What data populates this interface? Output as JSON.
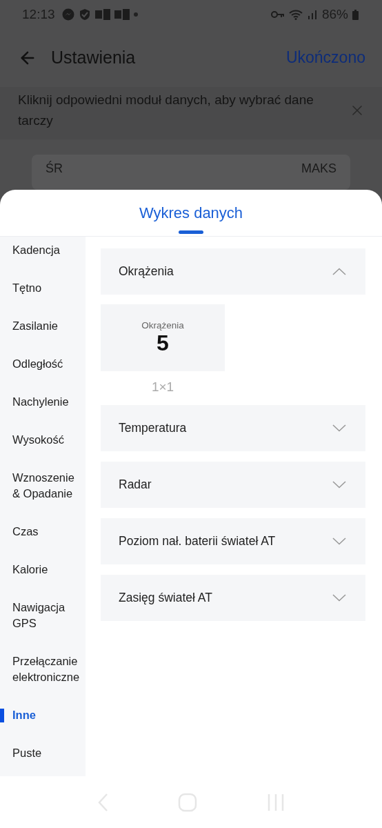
{
  "status_bar": {
    "time": "12:13",
    "battery": "86%"
  },
  "header": {
    "title": "Ustawienia",
    "action": "Ukończono"
  },
  "banner": {
    "text": "Kliknij odpowiedni moduł danych, aby wybrać dane tarczy"
  },
  "card": {
    "left": "ŚR",
    "right": "MAKS"
  },
  "sheet": {
    "title": "Wykres danych",
    "categories": [
      {
        "label": "Kadencja",
        "selected": false
      },
      {
        "label": "Tętno",
        "selected": false
      },
      {
        "label": "Zasilanie",
        "selected": false
      },
      {
        "label": "Odległość",
        "selected": false
      },
      {
        "label": "Nachylenie",
        "selected": false
      },
      {
        "label": "Wysokość",
        "selected": false
      },
      {
        "label": "Wznoszenie & Opadanie",
        "selected": false
      },
      {
        "label": "Czas",
        "selected": false
      },
      {
        "label": "Kalorie",
        "selected": false
      },
      {
        "label": "Nawigacja GPS",
        "selected": false
      },
      {
        "label": "Przełączanie elektroniczne",
        "selected": false
      },
      {
        "label": "Inne",
        "selected": true
      },
      {
        "label": "Puste",
        "selected": false
      }
    ],
    "sections": [
      {
        "title": "Okrążenia",
        "expanded": true,
        "tiles": [
          {
            "label": "Okrążenia",
            "value": "5",
            "size": "1×1"
          }
        ]
      },
      {
        "title": "Temperatura",
        "expanded": false
      },
      {
        "title": "Radar",
        "expanded": false
      },
      {
        "title": "Poziom nał. baterii świateł AT",
        "expanded": false
      },
      {
        "title": "Zasięg świateł AT",
        "expanded": false
      }
    ]
  }
}
